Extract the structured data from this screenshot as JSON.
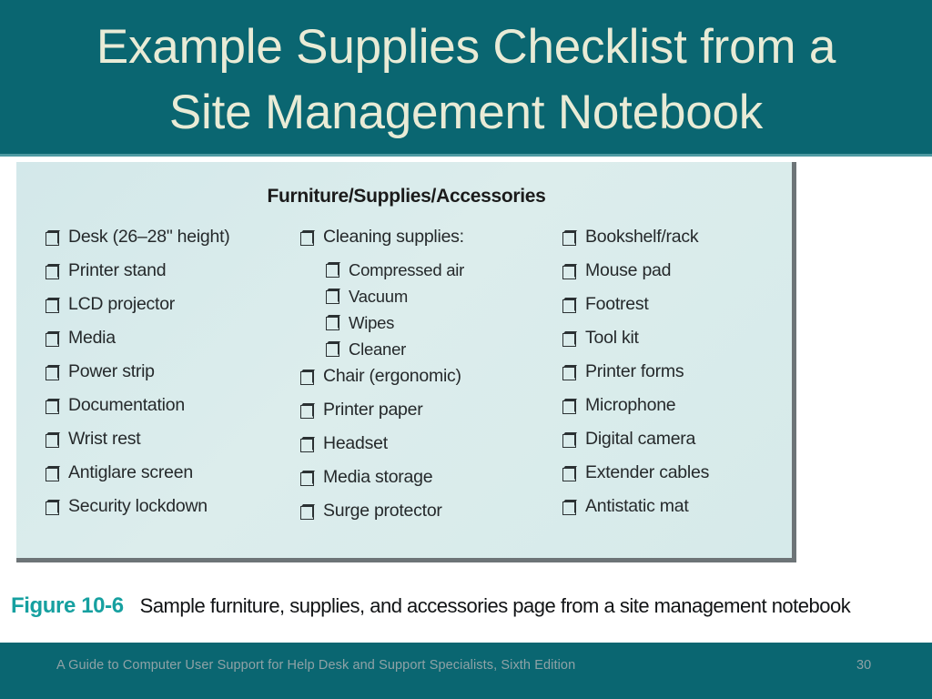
{
  "slide": {
    "title": "Example Supplies Checklist from a\nSite Management Notebook",
    "title_band_color": "#0a6671",
    "title_text_color": "#e9ebd6"
  },
  "figure_panel": {
    "heading": "Furniture/Supplies/Accessories",
    "background_color": "#d7eaea",
    "border_color": "#6d7477",
    "checkbox_icon": "empty-checkbox-icon",
    "columns": [
      {
        "id": "column-1",
        "items": [
          {
            "label": "Desk (26–28\" height)",
            "level": 0
          },
          {
            "label": "Printer stand",
            "level": 0
          },
          {
            "label": "LCD projector",
            "level": 0
          },
          {
            "label": "Media",
            "level": 0
          },
          {
            "label": "Power strip",
            "level": 0
          },
          {
            "label": "Documentation",
            "level": 0
          },
          {
            "label": "Wrist rest",
            "level": 0
          },
          {
            "label": "Antiglare screen",
            "level": 0
          },
          {
            "label": "Security lockdown",
            "level": 0
          }
        ]
      },
      {
        "id": "column-2",
        "items": [
          {
            "label": "Cleaning supplies:",
            "level": 0
          },
          {
            "label": "Compressed air",
            "level": 1
          },
          {
            "label": "Vacuum",
            "level": 1
          },
          {
            "label": "Wipes",
            "level": 1
          },
          {
            "label": "Cleaner",
            "level": 1
          },
          {
            "label": "Chair (ergonomic)",
            "level": 0
          },
          {
            "label": "Printer paper",
            "level": 0
          },
          {
            "label": "Headset",
            "level": 0
          },
          {
            "label": "Media storage",
            "level": 0
          },
          {
            "label": "Surge protector",
            "level": 0
          }
        ]
      },
      {
        "id": "column-3",
        "items": [
          {
            "label": "Bookshelf/rack",
            "level": 0
          },
          {
            "label": "Mouse pad",
            "level": 0
          },
          {
            "label": "Footrest",
            "level": 0
          },
          {
            "label": "Tool kit",
            "level": 0
          },
          {
            "label": "Printer forms",
            "level": 0
          },
          {
            "label": "Microphone",
            "level": 0
          },
          {
            "label": "Digital camera",
            "level": 0
          },
          {
            "label": "Extender cables",
            "level": 0
          },
          {
            "label": "Antistatic mat",
            "level": 0
          }
        ]
      }
    ]
  },
  "caption": {
    "figure_number": "Figure 10-6",
    "text": "Sample furniture, supplies, and accessories page from a site management notebook",
    "figure_number_color": "#16a0a0"
  },
  "footer": {
    "text": "A Guide to Computer User Support for Help Desk and Support Specialists, Sixth Edition",
    "page_number": "30",
    "band_color": "#0a6671",
    "text_color": "#8fa2a6"
  }
}
